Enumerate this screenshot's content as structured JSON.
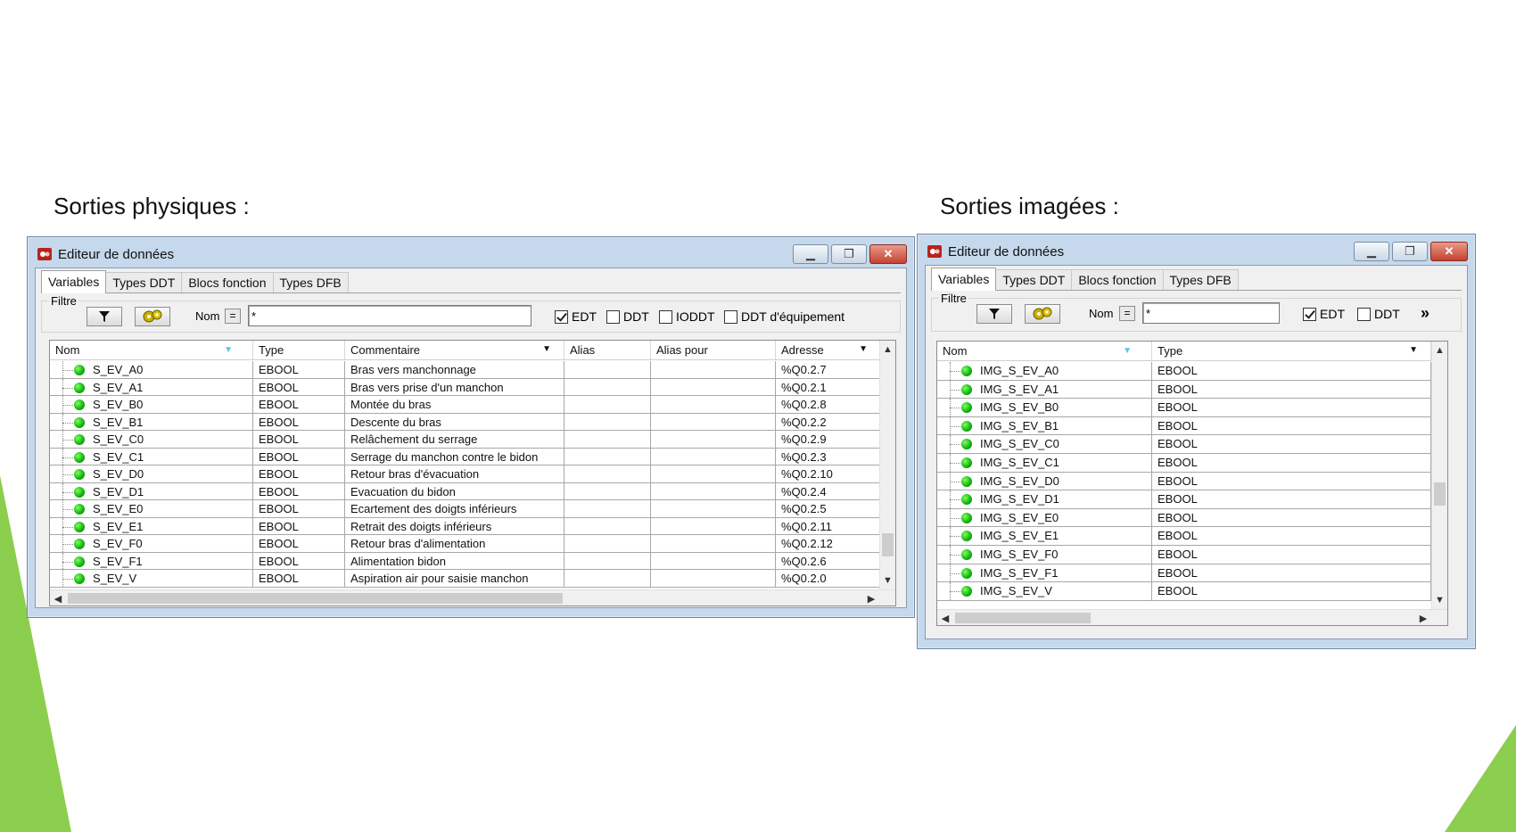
{
  "left": {
    "section_title": "Sorties physiques :",
    "window_title": "Editeur de données",
    "tabs": [
      "Variables",
      "Types DDT",
      "Blocs fonction",
      "Types DFB"
    ],
    "filter": {
      "label": "Filtre",
      "nom_label": "Nom",
      "eq_label": "=",
      "value": "*",
      "checks": [
        {
          "label": "EDT",
          "checked": true
        },
        {
          "label": "DDT",
          "checked": false
        },
        {
          "label": "IODDT",
          "checked": false
        },
        {
          "label": "DDT d'équipement",
          "checked": false
        }
      ]
    },
    "columns": [
      "Nom",
      "Type",
      "Commentaire",
      "Alias",
      "Alias pour",
      "Adresse"
    ],
    "rows": [
      [
        "S_EV_A0",
        "EBOOL",
        "Bras vers manchonnage",
        "",
        "",
        "%Q0.2.7"
      ],
      [
        "S_EV_A1",
        "EBOOL",
        "Bras vers prise d'un manchon",
        "",
        "",
        "%Q0.2.1"
      ],
      [
        "S_EV_B0",
        "EBOOL",
        "Montée du bras",
        "",
        "",
        "%Q0.2.8"
      ],
      [
        "S_EV_B1",
        "EBOOL",
        "Descente du bras",
        "",
        "",
        "%Q0.2.2"
      ],
      [
        "S_EV_C0",
        "EBOOL",
        "Relâchement du serrage",
        "",
        "",
        "%Q0.2.9"
      ],
      [
        "S_EV_C1",
        "EBOOL",
        "Serrage du manchon contre le bidon",
        "",
        "",
        "%Q0.2.3"
      ],
      [
        "S_EV_D0",
        "EBOOL",
        "Retour bras d'évacuation",
        "",
        "",
        "%Q0.2.10"
      ],
      [
        "S_EV_D1",
        "EBOOL",
        "Evacuation du bidon",
        "",
        "",
        "%Q0.2.4"
      ],
      [
        "S_EV_E0",
        "EBOOL",
        "Ecartement des doigts inférieurs",
        "",
        "",
        "%Q0.2.5"
      ],
      [
        "S_EV_E1",
        "EBOOL",
        "Retrait des doigts inférieurs",
        "",
        "",
        "%Q0.2.11"
      ],
      [
        "S_EV_F0",
        "EBOOL",
        "Retour bras d'alimentation",
        "",
        "",
        "%Q0.2.12"
      ],
      [
        "S_EV_F1",
        "EBOOL",
        "Alimentation bidon",
        "",
        "",
        "%Q0.2.6"
      ],
      [
        "S_EV_V",
        "EBOOL",
        "Aspiration air pour saisie manchon",
        "",
        "",
        "%Q0.2.0"
      ]
    ]
  },
  "right": {
    "section_title": "Sorties imagées :",
    "window_title": "Editeur de données",
    "tabs": [
      "Variables",
      "Types DDT",
      "Blocs fonction",
      "Types DFB"
    ],
    "filter": {
      "label": "Filtre",
      "nom_label": "Nom",
      "eq_label": "=",
      "value": "*",
      "checks": [
        {
          "label": "EDT",
          "checked": true
        },
        {
          "label": "DDT",
          "checked": false
        }
      ],
      "more": "»"
    },
    "columns": [
      "Nom",
      "Type"
    ],
    "rows": [
      [
        "IMG_S_EV_A0",
        "EBOOL"
      ],
      [
        "IMG_S_EV_A1",
        "EBOOL"
      ],
      [
        "IMG_S_EV_B0",
        "EBOOL"
      ],
      [
        "IMG_S_EV_B1",
        "EBOOL"
      ],
      [
        "IMG_S_EV_C0",
        "EBOOL"
      ],
      [
        "IMG_S_EV_C1",
        "EBOOL"
      ],
      [
        "IMG_S_EV_D0",
        "EBOOL"
      ],
      [
        "IMG_S_EV_D1",
        "EBOOL"
      ],
      [
        "IMG_S_EV_E0",
        "EBOOL"
      ],
      [
        "IMG_S_EV_E1",
        "EBOOL"
      ],
      [
        "IMG_S_EV_F0",
        "EBOOL"
      ],
      [
        "IMG_S_EV_F1",
        "EBOOL"
      ],
      [
        "IMG_S_EV_V",
        "EBOOL"
      ]
    ]
  },
  "colors": {
    "accent_green": "#8ccf4e",
    "status_dot": "#10b010",
    "sort_indicator": "#5dc3e8"
  }
}
